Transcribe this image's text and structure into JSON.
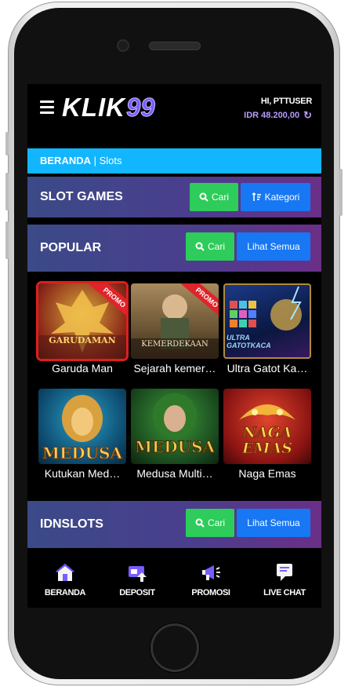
{
  "header": {
    "logo_text": "KLIK",
    "logo_number": "99",
    "user_greeting": "HI, PTTUSER",
    "balance": "IDR 48.200,00"
  },
  "breadcrumb": {
    "home": "BERANDA",
    "separator": " | ",
    "current": "Slots"
  },
  "slot_games": {
    "title": "SLOT GAMES",
    "search_label": "Cari",
    "category_label": "Kategori"
  },
  "popular": {
    "title": "POPULAR",
    "search_label": "Cari",
    "see_all_label": "Lihat Semua",
    "games": [
      {
        "name": "Garuda Man",
        "promo": "PROMO",
        "art_text": "GARUDAMAN"
      },
      {
        "name": "Sejarah kemer…",
        "promo": "PROMO",
        "art_text": "KEMERDEKAAN"
      },
      {
        "name": "Ultra Gatot Ka…",
        "art_text": "ULTRA GATOTKACA"
      },
      {
        "name": "Kutukan Med…",
        "art_text": "MEDUSA"
      },
      {
        "name": "Medusa Multi…",
        "art_text": "MEDUSA"
      },
      {
        "name": "Naga Emas",
        "art_text": "NAGA EMAS"
      }
    ]
  },
  "idnslots": {
    "title": "IDNSLOTS",
    "search_label": "Cari",
    "see_all_label": "Lihat Semua"
  },
  "bottom_nav": [
    {
      "label": "BERANDA",
      "icon": "home-icon"
    },
    {
      "label": "DEPOSIT",
      "icon": "deposit-icon"
    },
    {
      "label": "PROMOSI",
      "icon": "megaphone-icon"
    },
    {
      "label": "LIVE CHAT",
      "icon": "chat-icon"
    }
  ],
  "colors": {
    "accent_green": "#2ecc5a",
    "accent_blue": "#1877f2",
    "breadcrumb_bg": "#12b6ff",
    "balance_purple": "#b79bff",
    "promo_red": "#e0242a"
  }
}
